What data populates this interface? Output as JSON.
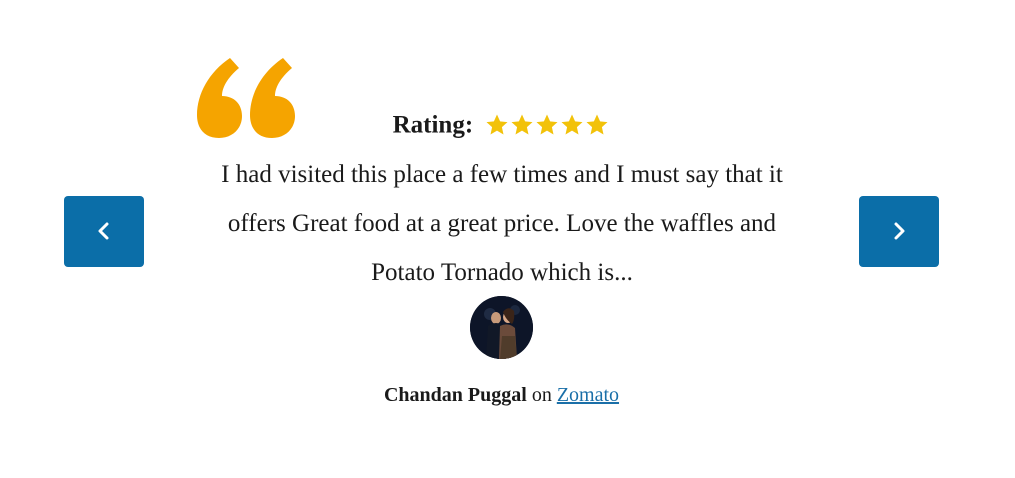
{
  "testimonial": {
    "rating_label": "Rating:",
    "rating": 5,
    "rating_max": 5,
    "review_text": "I had visited this place a few times and I must say that it offers Great food at a great price. Love the waffles and Potato Tornado which is...",
    "author_name": "Chandan Puggal",
    "connector": "on",
    "source": "Zomato"
  },
  "icons": {
    "quote": "quote-icon",
    "prev": "chevron-left-icon",
    "next": "chevron-right-icon",
    "star": "star-icon"
  },
  "colors": {
    "quote": "#f5a400",
    "star": "#f2c20a",
    "nav_button": "#0b6ea8",
    "link": "#1a6fa8",
    "text": "#1a1a1a"
  }
}
